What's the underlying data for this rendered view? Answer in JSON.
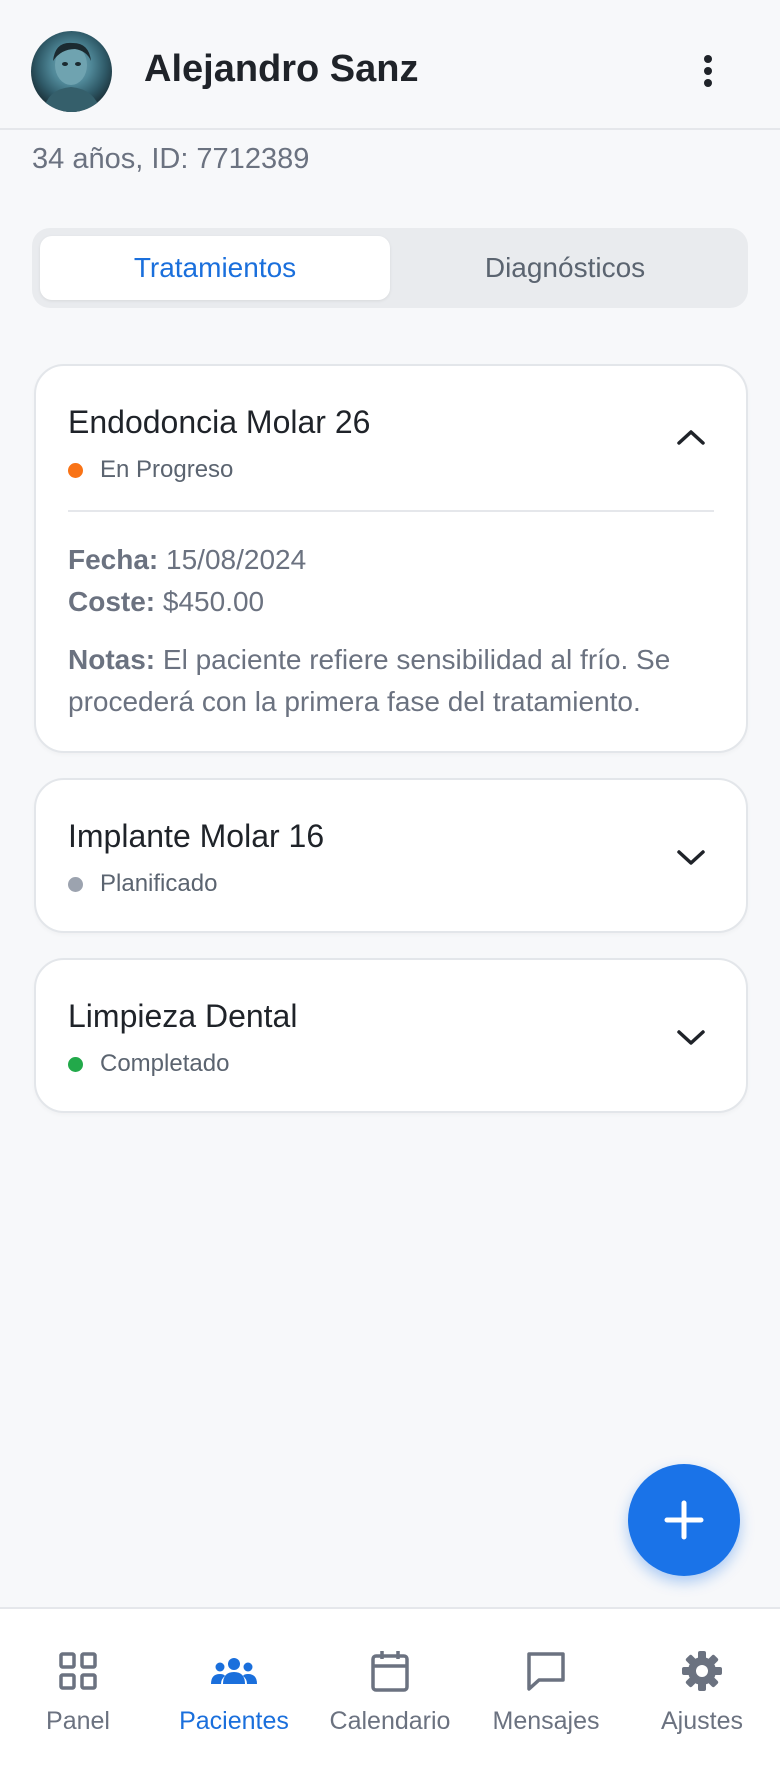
{
  "header": {
    "name": "Alejandro Sanz",
    "avatar_icon": "patient-avatar",
    "menu_icon": "more-vertical-icon"
  },
  "patient": {
    "summary": "34 años, ID: 7712389"
  },
  "tabs": [
    {
      "label": "Tratamientos",
      "active": true
    },
    {
      "label": "Diagnósticos",
      "active": false
    }
  ],
  "treatments": [
    {
      "title": "Endodoncia Molar 26",
      "status": "En Progreso",
      "status_color": "#f97316",
      "expanded": true,
      "fecha_label": "Fecha:",
      "fecha": "15/08/2024",
      "coste_label": "Coste:",
      "coste": "$450.00",
      "notas_label": "Notas:",
      "notas": "El paciente refiere sensibilidad al frío. Se procederá con la primera fase del tratamiento."
    },
    {
      "title": "Implante Molar 16",
      "status": "Planificado",
      "status_color": "#9ca3af",
      "expanded": false
    },
    {
      "title": "Limpieza Dental",
      "status": "Completado",
      "status_color": "#22a94a",
      "expanded": false
    }
  ],
  "fab": {
    "icon": "plus-icon"
  },
  "nav": [
    {
      "label": "Panel",
      "icon": "grid-icon",
      "active": false
    },
    {
      "label": "Pacientes",
      "icon": "users-icon",
      "active": true
    },
    {
      "label": "Calendario",
      "icon": "calendar-icon",
      "active": false
    },
    {
      "label": "Mensajes",
      "icon": "chat-icon",
      "active": false
    },
    {
      "label": "Ajustes",
      "icon": "gear-icon",
      "active": false
    }
  ],
  "colors": {
    "accent": "#1a73e8",
    "background": "#f7f8fa"
  }
}
